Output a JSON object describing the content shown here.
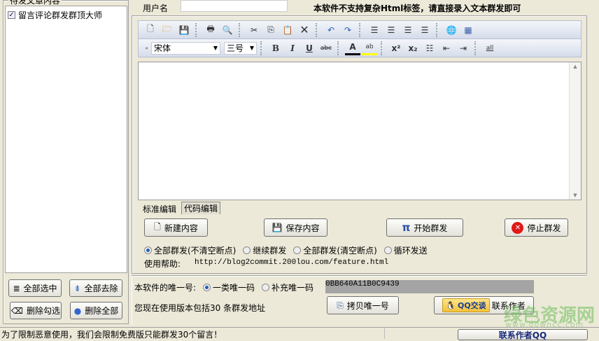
{
  "left": {
    "group_title": "待发文章内容",
    "items": [
      {
        "label": "留言评论群发群顶大师",
        "checked": true
      }
    ],
    "buttons": {
      "select_all": "全部选中",
      "remove_all": "全部去除",
      "delete_checked": "删除勾选",
      "delete_all": "删除全部"
    }
  },
  "header": {
    "username_label": "用户名",
    "username_value": "",
    "notice": "本软件不支持复杂Html标签，请直接录入文本群发即可"
  },
  "toolbar": {
    "font": "宋体",
    "size": "三号"
  },
  "editor": {
    "content": "",
    "tabs": [
      "标准编辑",
      "代码编辑"
    ],
    "active_tab": 0
  },
  "actions": {
    "new": "新建内容",
    "save": "保存内容",
    "start": "开始群发",
    "stop": "停止群发"
  },
  "modes": [
    {
      "label": "全部群发(不清空断点)",
      "selected": true
    },
    {
      "label": "继续群发",
      "selected": false
    },
    {
      "label": "全部群发(清空断点)",
      "selected": false
    },
    {
      "label": "循环发送",
      "selected": false
    }
  ],
  "help": {
    "label": "使用帮助:",
    "url": "http://blog2commit.200lou.com/feature.html"
  },
  "unique": {
    "label": "本软件的唯一号:",
    "options": [
      {
        "label": "一类唯一码",
        "selected": true
      },
      {
        "label": "补充唯一码",
        "selected": false
      }
    ],
    "code": "0BB640A11B0C9439",
    "copy_button": "拷贝唯一号"
  },
  "version_text": "您现在使用版本包括30 条群发地址",
  "qq": {
    "badge": "QQ交谈",
    "label": "联系作者"
  },
  "status": {
    "message": "为了限制恶意使用，我们会限制免费版只能群发30个留言！",
    "contact_button": "联系作者QQ"
  },
  "watermark": {
    "title": "绿色资源网",
    "url": "www.downcc.com"
  }
}
